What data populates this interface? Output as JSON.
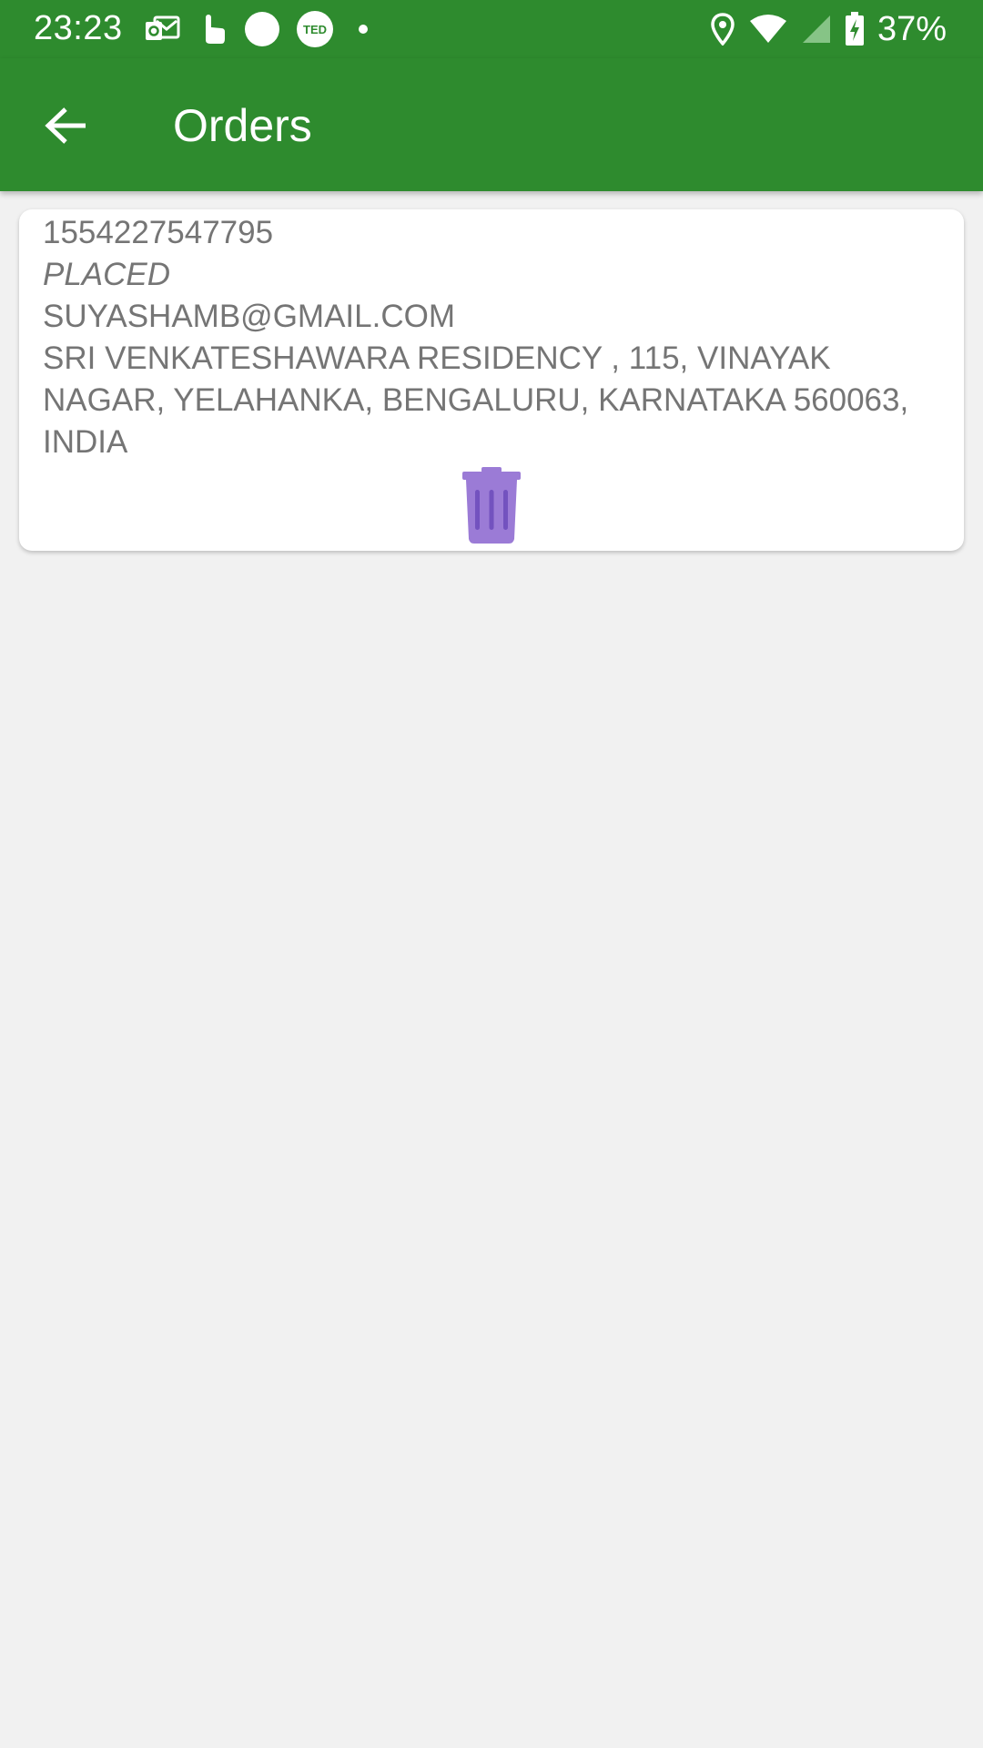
{
  "status_bar": {
    "time": "23:23",
    "battery_percent": "37%",
    "left_icons": [
      "outlook-icon",
      "touch-icon",
      "circle-icon",
      "ted-icon",
      "dot-icon"
    ],
    "ted_label": "TED",
    "right_icons": [
      "location-icon",
      "wifi-icon",
      "signal-icon",
      "battery-icon"
    ]
  },
  "app_bar": {
    "title": "Orders",
    "back_icon": "arrow-back-icon",
    "background_color": "#2e8b2e"
  },
  "orders": [
    {
      "id": "1554227547795",
      "status": "PLACED",
      "email": "SUYASHAMB@GMAIL.COM",
      "address": "SRI VENKATESHAWARA RESIDENCY , 115, VINAYAK NAGAR, YELAHANKA, BENGALURU, KARNATAKA 560063, INDIA",
      "delete_icon": "trash-icon",
      "delete_icon_color": "#9b7bd6"
    }
  ]
}
